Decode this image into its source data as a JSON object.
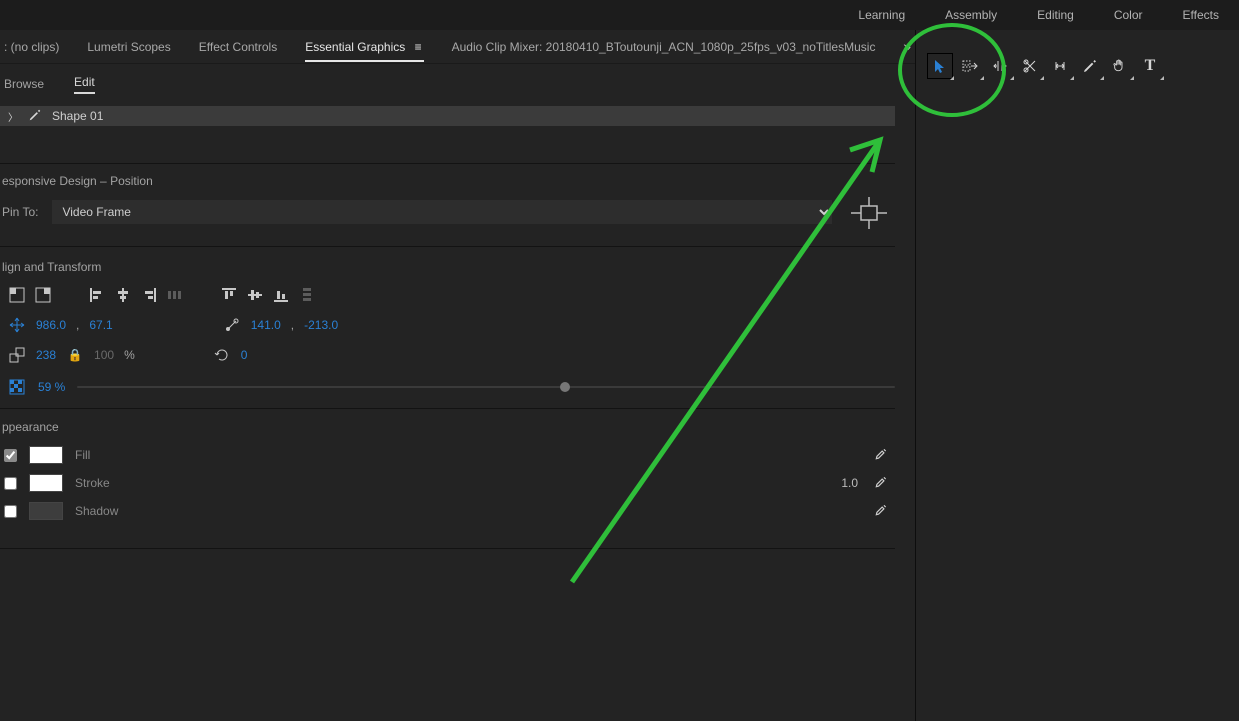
{
  "workspaces": {
    "items": [
      "Learning",
      "Assembly",
      "Editing",
      "Color",
      "Effects"
    ]
  },
  "panelTabs": {
    "noclips": ": (no clips)",
    "lumetri": "Lumetri Scopes",
    "effectControls": "Effect Controls",
    "essentialGraphics": "Essential Graphics",
    "audioMixer": "Audio Clip Mixer: 20180410_BToutounji_ACN_1080p_25fps_v03_noTitlesMusic"
  },
  "subtabs": {
    "browse": "Browse",
    "edit": "Edit"
  },
  "shape": {
    "name": "Shape 01"
  },
  "responsive": {
    "title": "esponsive Design – Position",
    "pinToLabel": "Pin To:",
    "pinToValue": "Video Frame"
  },
  "alignTransform": {
    "title": "lign and Transform",
    "posX": "986.0",
    "posY": "67.1",
    "anchorX": "141.0",
    "anchorY": "-213.0",
    "scale": "238",
    "scaleLocked": "100",
    "pct": "%",
    "rotation": "0",
    "opacity": "59 %"
  },
  "appearance": {
    "title": "ppearance",
    "fill": "Fill",
    "stroke": "Stroke",
    "strokeValue": "1.0",
    "shadow": "Shadow"
  },
  "tools": [
    "selection",
    "track-select",
    "ripple",
    "rate-stretch",
    "slip",
    "pen",
    "hand",
    "type"
  ],
  "icons": {
    "pen": "✒",
    "eyedropper": "💧",
    "hand": "✋",
    "type": "T"
  }
}
